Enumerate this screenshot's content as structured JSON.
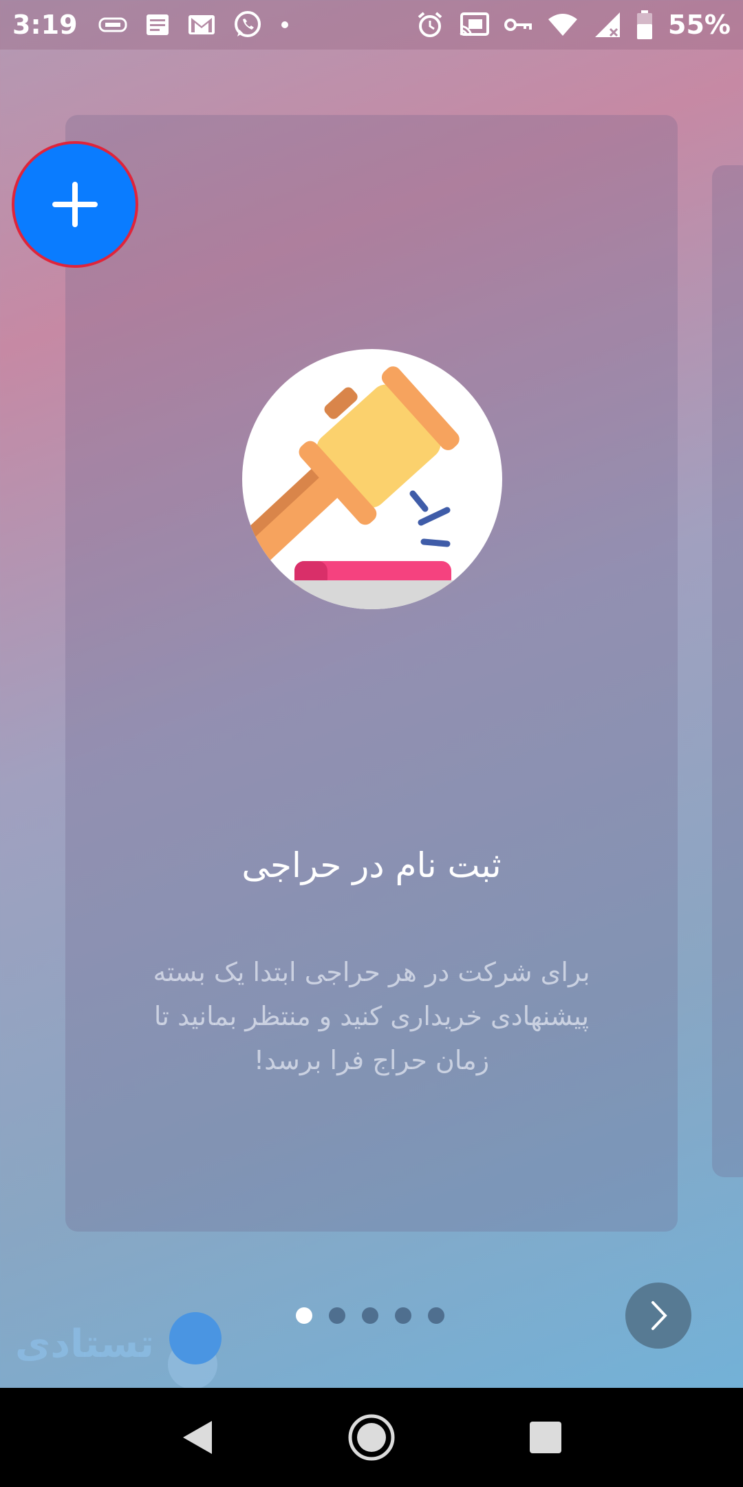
{
  "status_bar": {
    "time": "3:19",
    "battery": "55%",
    "left_icons": [
      "usb-icon",
      "news-icon",
      "gmail-icon",
      "whatsapp-icon",
      "dot-icon"
    ],
    "right_icons": [
      "alarm-icon",
      "cast-icon",
      "key-icon",
      "wifi-icon",
      "signal-icon",
      "battery-icon"
    ]
  },
  "onboarding": {
    "title": "ثبت نام در حراجی",
    "description": "برای شرکت در هر حراجی ابتدا یک بسته پیشنهادی خریداری کنید و منتظر بمانید تا زمان حراج فرا برسد!",
    "illustration": "auction-gavel-icon"
  },
  "pagination": {
    "count": 5,
    "active": 1
  },
  "fab_icon": "plus-icon",
  "next_icon": "chevron-right-icon",
  "watermark": {
    "text": "تستادی"
  },
  "nav": [
    "back-icon",
    "home-icon",
    "recents-icon"
  ],
  "colors": {
    "fab": "#0a7cff",
    "fab_border": "#e0243a",
    "next_button": "#577a93"
  }
}
